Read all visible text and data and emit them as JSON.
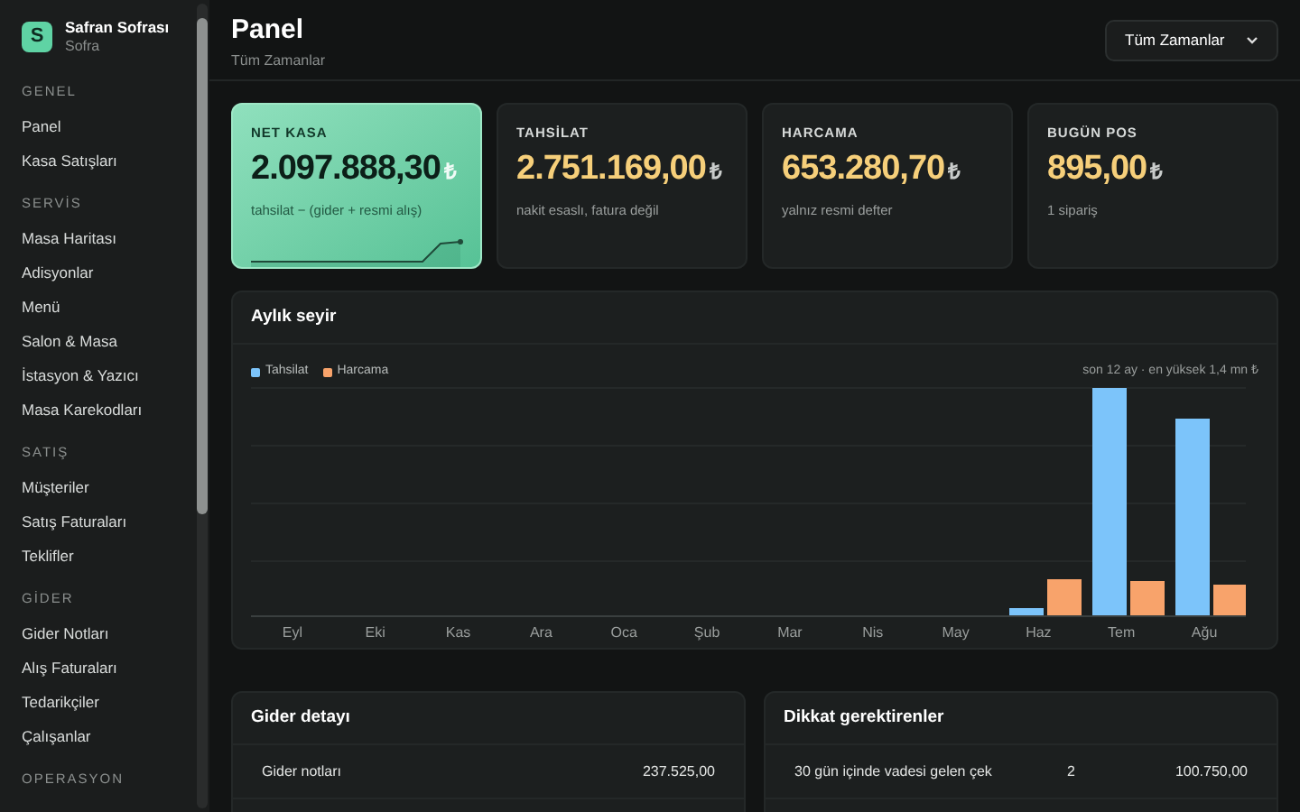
{
  "brand": {
    "logo": "S",
    "name": "Safran Sofrası",
    "subtitle": "Sofra"
  },
  "sidebar": {
    "sections": [
      {
        "title": "GENEL",
        "items": [
          {
            "label": "Panel"
          },
          {
            "label": "Kasa Satışları"
          }
        ]
      },
      {
        "title": "SERVİS",
        "items": [
          {
            "label": "Masa Haritası"
          },
          {
            "label": "Adisyonlar"
          },
          {
            "label": "Menü"
          },
          {
            "label": "Salon & Masa"
          },
          {
            "label": "İstasyon & Yazıcı"
          },
          {
            "label": "Masa Karekodları"
          }
        ]
      },
      {
        "title": "SATIŞ",
        "items": [
          {
            "label": "Müşteriler"
          },
          {
            "label": "Satış Faturaları"
          },
          {
            "label": "Teklifler"
          }
        ]
      },
      {
        "title": "GİDER",
        "items": [
          {
            "label": "Gider Notları"
          },
          {
            "label": "Alış Faturaları"
          },
          {
            "label": "Tedarikçiler"
          },
          {
            "label": "Çalışanlar"
          }
        ]
      },
      {
        "title": "OPERASYON"
      }
    ]
  },
  "header": {
    "title": "Panel",
    "subtitle": "Tüm Zamanlar",
    "period_select": "Tüm Zamanlar"
  },
  "kpis": [
    {
      "label": "NET KASA",
      "value": "2.097.888,30",
      "currency": "₺",
      "note": "tahsilat − (gider + resmi alış)",
      "highlighted": true
    },
    {
      "label": "TAHSİLAT",
      "value": "2.751.169,00",
      "currency": "₺",
      "note": "nakit esaslı, fatura değil",
      "highlighted": false
    },
    {
      "label": "HARCAMA",
      "value": "653.280,70",
      "currency": "₺",
      "note": "yalnız resmi defter",
      "highlighted": false
    },
    {
      "label": "BUGÜN POS",
      "value": "895,00",
      "currency": "₺",
      "note": "1 sipariş",
      "highlighted": false
    }
  ],
  "monthly": {
    "title": "Aylık seyir",
    "legend": [
      {
        "label": "Tahsilat",
        "color": "#7cc4fa"
      },
      {
        "label": "Harcama",
        "color": "#f8a36b"
      }
    ],
    "caption": "son 12 ay · en yüksek 1,4 mn ₺",
    "months": [
      "Eyl",
      "Eki",
      "Kas",
      "Ara",
      "Oca",
      "Şub",
      "Mar",
      "Nis",
      "May",
      "Haz",
      "Tem",
      "Ağu"
    ]
  },
  "expense_detail": {
    "title": "Gider detayı",
    "rows": [
      {
        "label": "Gider notları",
        "amount": "237.525,00"
      }
    ]
  },
  "attention": {
    "title": "Dikkat gerektirenler",
    "rows": [
      {
        "label": "30 gün içinde vadesi gelen çek",
        "count": "2",
        "amount": "100.750,00"
      }
    ]
  }
}
